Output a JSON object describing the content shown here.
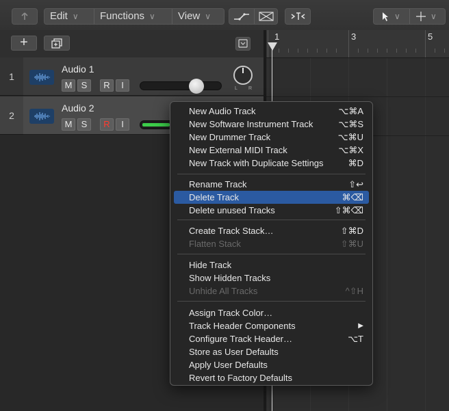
{
  "toolbar": {
    "back_icon": "back-arrow-icon",
    "edit_label": "Edit",
    "functions_label": "Functions",
    "view_label": "View",
    "chevron": "∨"
  },
  "ruler": {
    "bars": [
      "1",
      "3",
      "5"
    ]
  },
  "tracks": [
    {
      "number": "1",
      "name": "Audio 1",
      "mute": "M",
      "solo": "S",
      "record": "R",
      "input": "I",
      "fader_level": 0.72,
      "pan_l": "L",
      "pan_r": "R"
    },
    {
      "number": "2",
      "name": "Audio 2",
      "mute": "M",
      "solo": "S",
      "record": "R",
      "input": "I",
      "record_enabled": true,
      "meter_color": "#3ccd4a"
    }
  ],
  "menu": {
    "highlight_color": "#2b5aa1",
    "items": [
      {
        "label": "New Audio Track",
        "shortcut": "⌥⌘A"
      },
      {
        "label": "New Software Instrument Track",
        "shortcut": "⌥⌘S"
      },
      {
        "label": "New Drummer Track",
        "shortcut": "⌥⌘U"
      },
      {
        "label": "New External MIDI Track",
        "shortcut": "⌥⌘X"
      },
      {
        "label": "New Track with Duplicate Settings",
        "shortcut": "⌘D"
      },
      {
        "label": "Rename Track",
        "shortcut": "⇧↩"
      },
      {
        "label": "Delete Track",
        "shortcut": "⌘⌫",
        "highlighted": true
      },
      {
        "label": "Delete unused Tracks",
        "shortcut": "⇧⌘⌫"
      },
      {
        "label": "Create Track Stack…",
        "shortcut": "⇧⌘D"
      },
      {
        "label": "Flatten Stack",
        "shortcut": "⇧⌘U",
        "disabled": true
      },
      {
        "label": "Hide Track",
        "shortcut": ""
      },
      {
        "label": "Show Hidden Tracks",
        "shortcut": ""
      },
      {
        "label": "Unhide All Tracks",
        "shortcut": "^⇧H",
        "disabled": true
      },
      {
        "label": "Assign Track Color…",
        "shortcut": ""
      },
      {
        "label": "Track Header Components",
        "shortcut": "▶"
      },
      {
        "label": "Configure Track Header…",
        "shortcut": "⌥T"
      },
      {
        "label": "Store as User Defaults",
        "shortcut": ""
      },
      {
        "label": "Apply User Defaults",
        "shortcut": ""
      },
      {
        "label": "Revert to Factory Defaults",
        "shortcut": ""
      }
    ]
  }
}
